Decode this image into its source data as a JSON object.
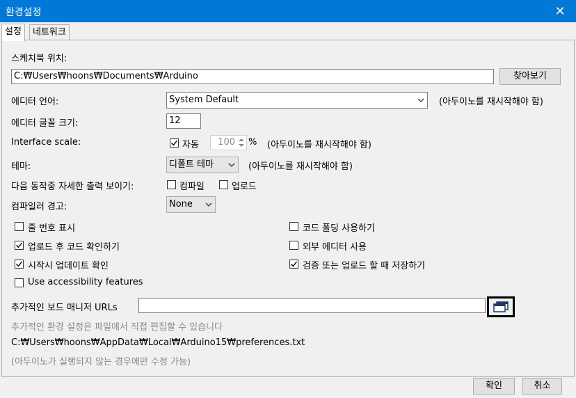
{
  "window": {
    "title": "환경설정",
    "close_glyph": "✕"
  },
  "tabs": [
    {
      "label": "설정",
      "active": true
    },
    {
      "label": "네트워크",
      "active": false
    }
  ],
  "sketchbook": {
    "label": "스케치북 위치:",
    "path": "C:₩Users₩hoons₩Documents₩Arduino",
    "browse_label": "찾아보기"
  },
  "editor_language": {
    "label": "에디터 언어:",
    "selected": "System Default",
    "note": "(아두이노를 재시작해야 함)"
  },
  "font_size": {
    "label": "에디터 글꼴 크기:",
    "value": "12"
  },
  "interface_scale": {
    "label": "Interface scale:",
    "auto_label": "자동",
    "auto_checked": true,
    "value": "100",
    "unit": "%",
    "note": "(아두이노를 재시작해야 함)"
  },
  "theme": {
    "label": "테마:",
    "selected": "디폴트 테마",
    "note": "(아두이노를 재시작해야 함)"
  },
  "verbose": {
    "label": "다음 동작중 자세한  출력 보이기:",
    "compile_label": "컴파일",
    "upload_label": "업로드"
  },
  "compiler_warnings": {
    "label": "컴파일러 경고:",
    "selected": "None"
  },
  "options_left": [
    {
      "label": "줄 번호 표시",
      "checked": false
    },
    {
      "label": "업로드 후 코드 확인하기",
      "checked": true
    },
    {
      "label": "시작시 업데이트 확인",
      "checked": true
    },
    {
      "label": "Use accessibility features",
      "checked": false
    }
  ],
  "options_right": [
    {
      "label": "코드 폴딩 사용하기",
      "checked": false
    },
    {
      "label": "외부 에디터 사용",
      "checked": false
    },
    {
      "label": "검증 또는 업로드 할 때 저장하기",
      "checked": true
    }
  ],
  "board_urls": {
    "label": "추가적인 보드 매니저 URLs",
    "value": ""
  },
  "more_prefs_hint": "추가적인 환경 설정은 파일에서 직접 편집할 수 있습니다",
  "prefs_path": "C:₩Users₩hoons₩AppData₩Local₩Arduino15₩preferences.txt",
  "edit_note": "(아두이노가 실행되지 않는 경우에만 수정 가능)",
  "footer": {
    "ok_label": "확인",
    "cancel_label": "취소"
  },
  "colors": {
    "titlebar": "#0078d7",
    "highlight_border": "#000000"
  }
}
